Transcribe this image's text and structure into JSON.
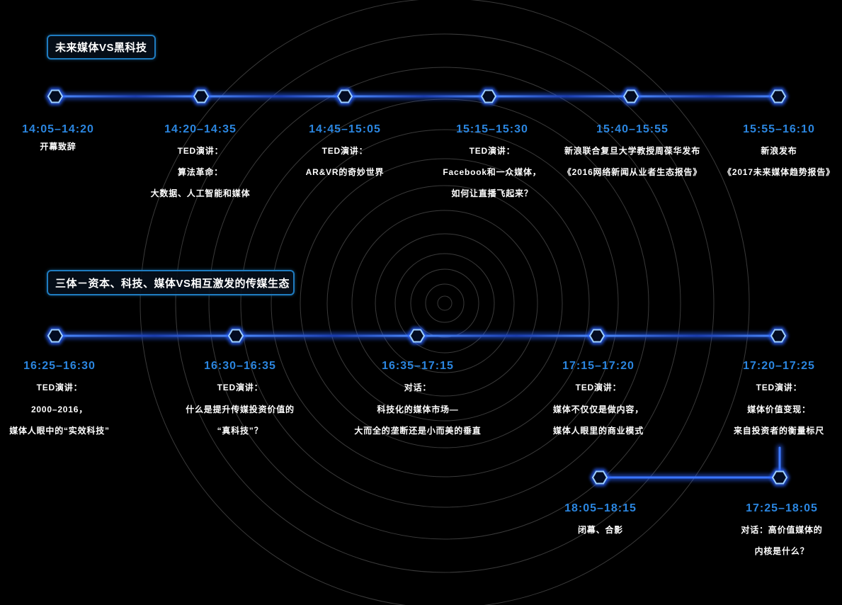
{
  "sections": [
    {
      "title": "未来媒体VS黑科技",
      "items": [
        {
          "time": "14:05–14:20",
          "lines": [
            "开幕致辞"
          ]
        },
        {
          "time": "14:20–14:35",
          "lines": [
            "TED演讲：",
            "算法革命：",
            "大数据、人工智能和媒体"
          ]
        },
        {
          "time": "14:45–15:05",
          "lines": [
            "TED演讲：",
            "AR&VR的奇妙世界"
          ]
        },
        {
          "time": "15:15–15:30",
          "lines": [
            "TED演讲：",
            "Facebook和一众媒体，",
            "如何让直播飞起来？"
          ]
        },
        {
          "time": "15:40–15:55",
          "lines": [
            "新浪联合复旦大学教授周葆华发布",
            "《2016网络新闻从业者生态报告》"
          ]
        },
        {
          "time": "15:55–16:10",
          "lines": [
            "新浪发布",
            "《2017未来媒体趋势报告》"
          ]
        }
      ]
    },
    {
      "title": "三体－资本、科技、媒体VS相互激发的传媒生态",
      "items": [
        {
          "time": "16:25–16:30",
          "lines": [
            "TED演讲：",
            "2000–2016，",
            "媒体人眼中的“实效科技”"
          ]
        },
        {
          "time": "16:30–16:35",
          "lines": [
            "TED演讲：",
            "什么是提升传媒投资价值的",
            "“真科技”？"
          ]
        },
        {
          "time": "16:35–17:15",
          "lines": [
            "对话：",
            "科技化的媒体市场—",
            "大而全的垄断还是小而美的垂直"
          ]
        },
        {
          "time": "17:15–17:20",
          "lines": [
            "TED演讲：",
            "媒体不仅仅是做内容，",
            "媒体人眼里的商业模式"
          ]
        },
        {
          "time": "17:20–17:25",
          "lines": [
            "TED演讲：",
            "媒体价值变现：",
            "来自投资者的衡量标尺"
          ]
        },
        {
          "time": "17:25–18:05",
          "lines": [
            "对话：高价值媒体的",
            "内核是什么？"
          ]
        },
        {
          "time": "18:05–18:15",
          "lines": [
            "闭幕、合影"
          ]
        }
      ]
    }
  ],
  "colors": {
    "background": "#000000",
    "time_text": "#2b86e0",
    "body_text": "#ffffff",
    "title_border": "#1f7cc0",
    "timeline": "#2a62ff",
    "node_outline": "#9fd0ff",
    "rings": "#3a3a3a"
  }
}
